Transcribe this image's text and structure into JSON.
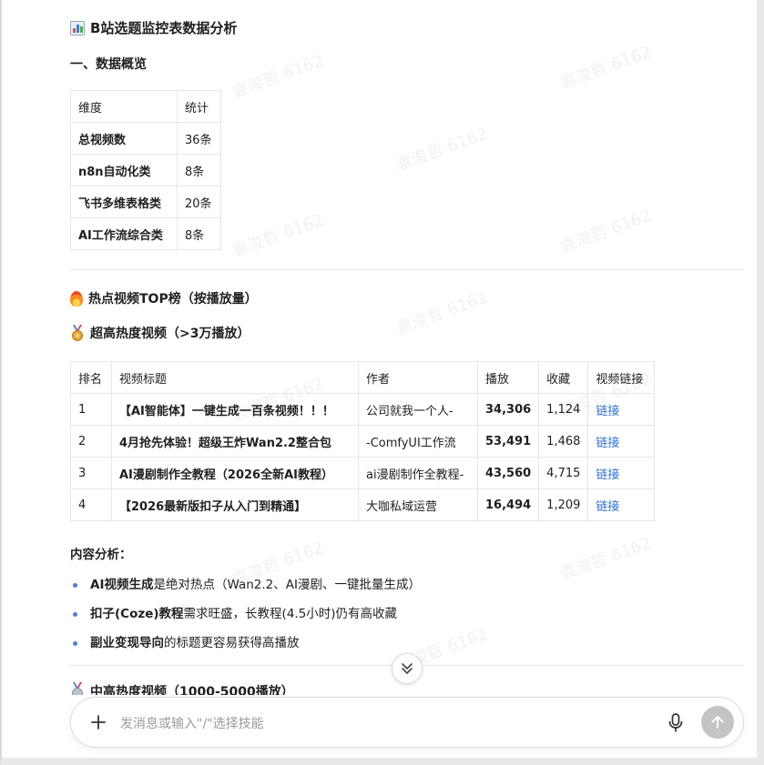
{
  "title": "B站选题监控表数据分析",
  "overview": {
    "heading": "一、数据概览",
    "header": [
      "维度",
      "统计"
    ],
    "rows": [
      [
        "总视频数",
        "36条"
      ],
      [
        "n8n自动化类",
        "8条"
      ],
      [
        "飞书多维表格类",
        "20条"
      ],
      [
        "AI工作流综合类",
        "8条"
      ]
    ]
  },
  "hot": {
    "heading": "热点视频TOP榜（按播放量）",
    "sub_heading": "超高热度视频（>3万播放）",
    "header": [
      "排名",
      "视频标题",
      "作者",
      "播放",
      "收藏",
      "视频链接"
    ],
    "rows": [
      {
        "rank": "1",
        "title": "【AI智能体】一键生成一百条视频！！！",
        "author": "公司就我一个人-",
        "plays": "34,306",
        "favs": "1,124",
        "link": "链接"
      },
      {
        "rank": "2",
        "title": "4月抢先体验！超级王炸Wan2.2整合包",
        "author": "-ComfyUI工作流",
        "plays": "53,491",
        "favs": "1,468",
        "link": "链接"
      },
      {
        "rank": "3",
        "title": "AI漫剧制作全教程（2026全新AI教程）",
        "author": "ai漫剧制作全教程-",
        "plays": "43,560",
        "favs": "4,715",
        "link": "链接"
      },
      {
        "rank": "4",
        "title": "【2026最新版扣子从入门到精通】",
        "author": "大咖私域运营",
        "plays": "16,494",
        "favs": "1,209",
        "link": "链接"
      }
    ]
  },
  "analysis": {
    "title": "内容分析：",
    "items": [
      {
        "bold": "AI视频生成",
        "rest": "是绝对热点（Wan2.2、AI漫剧、一键批量生成）"
      },
      {
        "bold": "扣子(Coze)教程",
        "rest": "需求旺盛，长教程(4.5小时)仍有高收藏"
      },
      {
        "bold": "副业变现导向",
        "rest": "的标题更容易获得高播放"
      }
    ]
  },
  "next_heading": "中高热度视频（1000-5000播放）",
  "input": {
    "placeholder": "发消息或输入\"/\"选择技能"
  },
  "watermark": "袁浚哲 6162",
  "icons": {
    "title": "bar-chart-icon",
    "hot": "fire-icon",
    "sub": "medal-icon",
    "next": "medal-icon",
    "scroll": "chevron-double-down-icon",
    "add": "plus-icon",
    "mic": "microphone-icon",
    "send": "arrow-up-icon"
  },
  "colors": {
    "link": "#2f6fd6",
    "bullet": "#4a7fd4",
    "send_disabled": "#c4c4c4"
  }
}
